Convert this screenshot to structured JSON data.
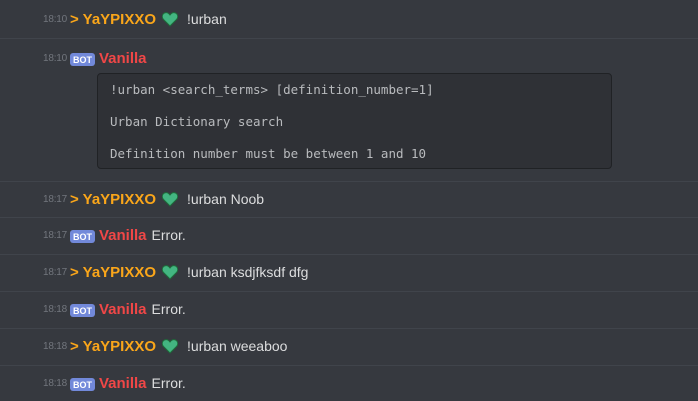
{
  "colors": {
    "background": "#36393f",
    "user_name": "#faa61a",
    "bot_name": "#f04747",
    "bot_tag": "#7289da",
    "heart": "#43b581"
  },
  "messages": [
    {
      "time": "18:10",
      "author": "> YaYPIXXO",
      "is_bot": false,
      "text": "!urban"
    },
    {
      "time": "18:10",
      "author": "Vanilla",
      "is_bot": true,
      "bot_tag": "BOT",
      "text": "",
      "code": [
        "!urban <search_terms> [definition_number=1]",
        "Urban Dictionary search",
        "Definition number must be between 1 and 10"
      ]
    },
    {
      "time": "18:17",
      "author": "> YaYPIXXO",
      "is_bot": false,
      "text": "!urban Noob"
    },
    {
      "time": "18:17",
      "author": "Vanilla",
      "is_bot": true,
      "bot_tag": "BOT",
      "text": "Error."
    },
    {
      "time": "18:17",
      "author": "> YaYPIXXO",
      "is_bot": false,
      "text": "!urban ksdjfksdf dfg"
    },
    {
      "time": "18:18",
      "author": "Vanilla",
      "is_bot": true,
      "bot_tag": "BOT",
      "text": "Error."
    },
    {
      "time": "18:18",
      "author": "> YaYPIXXO",
      "is_bot": false,
      "text": "!urban weeaboo"
    },
    {
      "time": "18:18",
      "author": "Vanilla",
      "is_bot": true,
      "bot_tag": "BOT",
      "text": "Error."
    }
  ]
}
